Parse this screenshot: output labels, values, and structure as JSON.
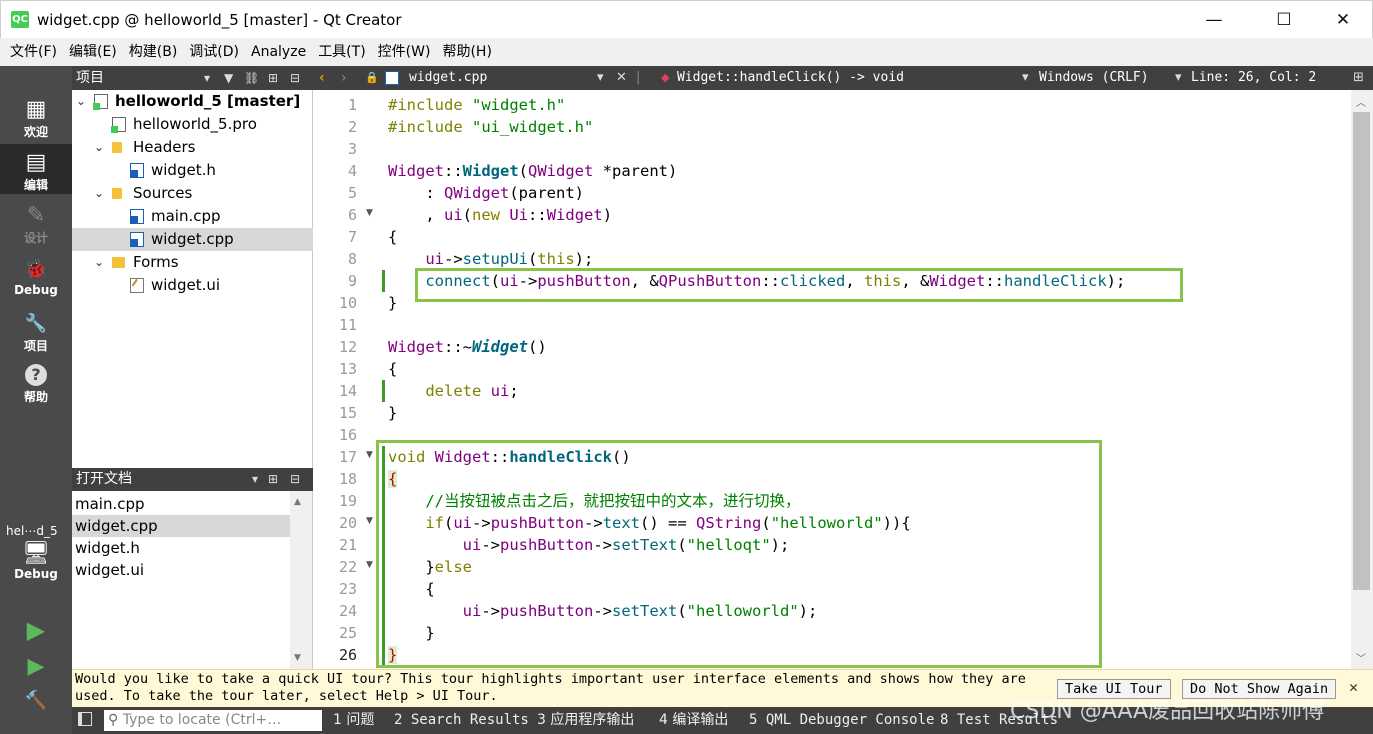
{
  "window": {
    "title": "widget.cpp @ helloworld_5 [master] - Qt Creator",
    "app_icon": "QC",
    "minimize": "—",
    "maximize": "☐",
    "close": "✕"
  },
  "menubar": [
    "文件(F)",
    "编辑(E)",
    "构建(B)",
    "调试(D)",
    "Analyze",
    "工具(T)",
    "控件(W)",
    "帮助(H)"
  ],
  "modes": [
    {
      "label": "欢迎",
      "icon": "▦"
    },
    {
      "label": "编辑",
      "icon": "▤"
    },
    {
      "label": "设计",
      "icon": "✎"
    },
    {
      "label": "Debug",
      "icon": "🐞"
    },
    {
      "label": "项目",
      "icon": "🔧"
    },
    {
      "label": "帮助",
      "icon": "?"
    }
  ],
  "target": {
    "project": "hel⋯d_5",
    "label": "Debug",
    "icon": "🖥"
  },
  "actions": {
    "run": "▶",
    "debug_run": "▶",
    "build": "🔨"
  },
  "project_panel": {
    "title": "项目",
    "items": [
      {
        "label": "helloworld_5 [master]",
        "bold": true
      },
      {
        "label": "helloworld_5.pro"
      },
      {
        "label": "Headers"
      },
      {
        "label": "widget.h"
      },
      {
        "label": "Sources"
      },
      {
        "label": "main.cpp"
      },
      {
        "label": "widget.cpp"
      },
      {
        "label": "Forms"
      },
      {
        "label": "widget.ui"
      }
    ]
  },
  "open_docs": {
    "title": "打开文档",
    "items": [
      "main.cpp",
      "widget.cpp",
      "widget.h",
      "widget.ui"
    ]
  },
  "editor_toolbar": {
    "file": "widget.cpp",
    "symbol": "Widget::handleClick() -> void",
    "line_endings": "Windows (CRLF)",
    "position": "Line: 26, Col: 2"
  },
  "line_numbers": [
    "1",
    "2",
    "3",
    "4",
    "5",
    "6",
    "7",
    "8",
    "9",
    "10",
    "11",
    "12",
    "13",
    "14",
    "15",
    "16",
    "17",
    "18",
    "19",
    "20",
    "21",
    "22",
    "23",
    "24",
    "25",
    "26"
  ],
  "code": [
    "#include \"widget.h\"",
    "#include \"ui_widget.h\"",
    "",
    "Widget::Widget(QWidget *parent)",
    "    : QWidget(parent)",
    "    , ui(new Ui::Widget)",
    "{",
    "    ui->setupUi(this);",
    "    connect(ui->pushButton, &QPushButton::clicked, this, &Widget::handleClick);",
    "}",
    "",
    "Widget::~Widget()",
    "{",
    "    delete ui;",
    "}",
    "",
    "void Widget::handleClick()",
    "{",
    "    //当按钮被点击之后，就把按钮中的文本，进行切换，",
    "    if(ui->pushButton->text() == QString(\"helloworld\")){",
    "        ui->pushButton->setText(\"helloqt\");",
    "    }else",
    "    {",
    "        ui->pushButton->setText(\"helloworld\");",
    "    }",
    "}"
  ],
  "tour": {
    "message": "Would you like to take a quick UI tour? This tour highlights important user interface elements and shows how they are used. To take the tour later, select Help > UI Tour.",
    "take": "Take UI Tour",
    "dont": "Do Not Show Again",
    "close": "✕"
  },
  "output_bar": {
    "locate_placeholder": "Type to locate (Ctrl+…",
    "tabs": [
      "1 问题",
      "2 Search Results",
      "3 应用程序输出",
      "4 编译输出",
      "5 QML Debugger Console",
      "8 Test Results"
    ]
  },
  "watermark": "CSDN @AAA废品回收站陈师傅",
  "colors": {
    "highlight_box": "#8bc34a",
    "modebar": "#4a4a4a",
    "panel_header": "#404040",
    "keyword": "#808000",
    "string": "#008000",
    "type": "#800080",
    "function": "#00677c"
  }
}
